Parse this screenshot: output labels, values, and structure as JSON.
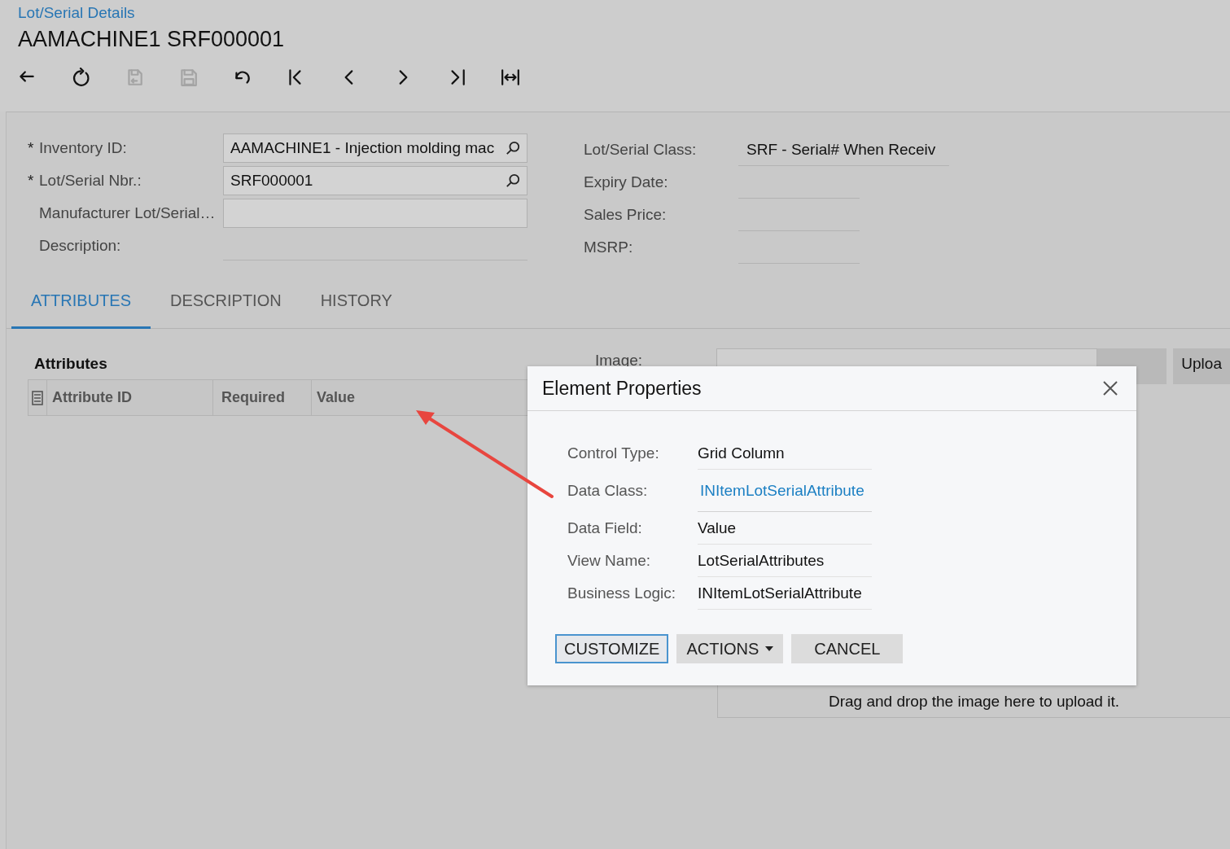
{
  "breadcrumb": "Lot/Serial Details",
  "title": "AAMACHINE1 SRF000001",
  "toolbar": [
    {
      "kind": "back",
      "disabled": false
    },
    {
      "kind": "refresh",
      "disabled": false
    },
    {
      "kind": "save-close",
      "disabled": true
    },
    {
      "kind": "save",
      "disabled": true
    },
    {
      "kind": "undo",
      "disabled": false
    },
    {
      "kind": "first",
      "disabled": false
    },
    {
      "kind": "prev",
      "disabled": false
    },
    {
      "kind": "next",
      "disabled": false
    },
    {
      "kind": "last",
      "disabled": false
    },
    {
      "kind": "fit",
      "disabled": false
    }
  ],
  "fields_left": [
    {
      "label": "Inventory ID:",
      "required_mark": "*",
      "kind": "lookup",
      "value": "AAMACHINE1 - Injection molding mac"
    },
    {
      "label": "Lot/Serial Nbr.:",
      "required_mark": "*",
      "kind": "lookup",
      "value": "SRF000001"
    },
    {
      "label": "Manufacturer Lot/Serial…",
      "kind": "box"
    },
    {
      "label": "Description:",
      "kind": "line"
    }
  ],
  "fields_right": [
    {
      "label": "Lot/Serial Class:",
      "value": "SRF - Serial# When Receiv"
    },
    {
      "label": "Expiry Date:"
    },
    {
      "label": "Sales Price:"
    },
    {
      "label": "MSRP:"
    }
  ],
  "tabs": [
    {
      "label": "ATTRIBUTES",
      "selected": true
    },
    {
      "label": "DESCRIPTION",
      "selected": false
    },
    {
      "label": "HISTORY",
      "selected": false
    }
  ],
  "attributes": {
    "title": "Attributes",
    "columns": [
      "Attribute ID",
      "Required",
      "Value"
    ]
  },
  "image": {
    "label": "Image:",
    "upload_button": "Uploa",
    "drop_hint": "Drag and drop the image here to upload it."
  },
  "dialog": {
    "title": "Element Properties",
    "rows": [
      {
        "label": "Control Type:",
        "value": "Grid Column",
        "kind": "text"
      },
      {
        "label": "Data Class:",
        "value": "INItemLotSerialAttribute",
        "kind": "link"
      },
      {
        "label": "Data Field:",
        "value": "Value",
        "kind": "text"
      },
      {
        "label": "View Name:",
        "value": "LotSerialAttributes",
        "kind": "text"
      },
      {
        "label": "Business Logic:",
        "value": "INItemLotSerialAttribute",
        "kind": "text"
      }
    ],
    "buttons": [
      {
        "label": "CUSTOMIZE",
        "focused": true,
        "dropdown": false
      },
      {
        "label": "ACTIONS",
        "focused": false,
        "dropdown": true
      },
      {
        "label": "CANCEL",
        "focused": false,
        "dropdown": false
      }
    ]
  }
}
